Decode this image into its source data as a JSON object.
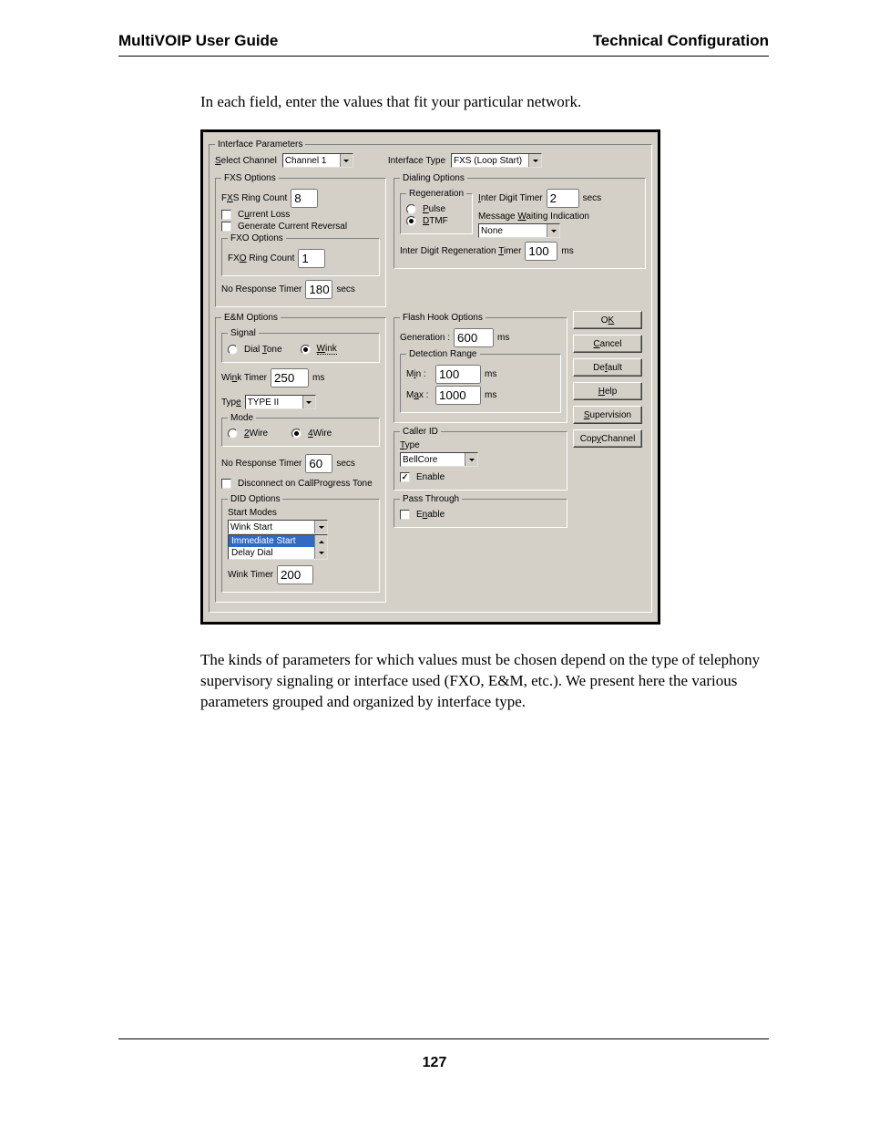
{
  "header": {
    "left": "MultiVOIP User Guide",
    "right": "Technical Configuration"
  },
  "intro": "In each field, enter the values that fit  your particular network.",
  "dialog": {
    "interface_parameters_title": "Interface Parameters",
    "select_channel_label": "Select Channel",
    "select_channel_value": "Channel 1",
    "interface_type_label": "Interface Type",
    "interface_type_value": "FXS (Loop Start)",
    "fxs": {
      "title": "FXS Options",
      "ring_count_label": "FXS Ring Count",
      "ring_count_value": "8",
      "current_loss_label": "Current  Loss",
      "gen_current_reversal_label": "Generate Current Reversal",
      "fxo_title": "FXO Options",
      "fxo_ring_count_label": "FXO Ring Count",
      "fxo_ring_count_value": "1",
      "no_response_label": "No Response Timer",
      "no_response_value": "180",
      "no_response_unit": "secs"
    },
    "dialing": {
      "title": "Dialing Options",
      "regen_title": "Regeneration",
      "pulse_label": "Pulse",
      "dtmf_label": "DTMF",
      "inter_digit_timer_label": "Inter Digit Timer",
      "inter_digit_timer_value": "2",
      "inter_digit_timer_unit": "secs",
      "mwi_label": "Message Waiting Indication",
      "mwi_value": "None",
      "idr_label": "Inter Digit Regeneration Timer",
      "idr_value": "100",
      "idr_unit": "ms"
    },
    "em": {
      "title": "E&M Options",
      "signal_title": "Signal",
      "dial_tone_label": "Dial Tone",
      "wink_label": "Wink",
      "wink_timer_label": "Wink Timer",
      "wink_timer_value": "250",
      "wink_timer_unit": "ms",
      "type_label": "Type",
      "type_value": "TYPE II",
      "mode_title": "Mode",
      "two_wire_label": "2Wire",
      "four_wire_label": "4Wire",
      "no_response_label": "No Response Timer",
      "no_response_value": "60",
      "no_response_unit": "secs",
      "disconnect_label": "Disconnect on CallProgress Tone"
    },
    "flash": {
      "title": "Flash Hook Options",
      "generation_label": "Generation :",
      "generation_value": "600",
      "generation_unit": "ms",
      "detection_title": "Detection Range",
      "min_label": "Min :",
      "min_value": "100",
      "min_unit": "ms",
      "max_label": "Max :",
      "max_value": "1000",
      "max_unit": "ms"
    },
    "callerid": {
      "title": "Caller ID",
      "type_label": "Type",
      "type_value": "BellCore",
      "enable_label": "Enable"
    },
    "passthrough": {
      "title": "Pass Through",
      "enable_label": "Enable"
    },
    "did": {
      "title": "DID Options",
      "start_modes_label": "Start Modes",
      "sel_value": "Wink Start",
      "list_a": "Immediate Start",
      "list_b": "Delay Dial",
      "wink_timer_label": "Wink Timer",
      "wink_timer_value": "200"
    },
    "buttons": {
      "ok": "OK",
      "cancel": "Cancel",
      "default": "Default",
      "help": "Help",
      "supervision": "Supervision",
      "copy": "Copy Channel"
    }
  },
  "body": "The kinds of parameters for which values must be chosen depend on the type of telephony supervisory signaling or interface used (FXO, E&M, etc.).  We present here the various parameters grouped and organized by interface type.",
  "page_number": "127"
}
